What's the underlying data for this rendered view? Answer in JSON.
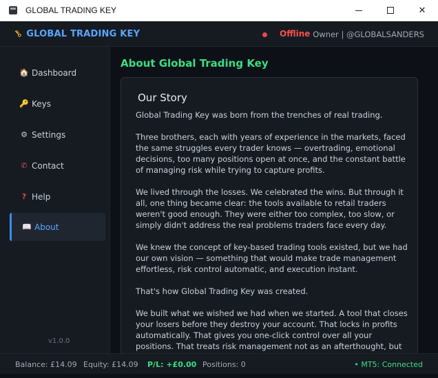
{
  "window": {
    "title": "GLOBAL TRADING KEY",
    "minimize": "",
    "maximize": "",
    "close": "✕"
  },
  "header": {
    "brand": "GLOBAL TRADING KEY",
    "status": "Offline",
    "owner": "Owner | @GLOBALSANDERS",
    "colors": {
      "brand": "#58a6ff",
      "offline": "#f85149"
    }
  },
  "sidebar": {
    "items": [
      {
        "label": "Dashboard",
        "icon": "home-icon"
      },
      {
        "label": "Keys",
        "icon": "key-icon"
      },
      {
        "label": "Settings",
        "icon": "gear-icon"
      },
      {
        "label": "Contact",
        "icon": "phone-icon"
      },
      {
        "label": "Help",
        "icon": "question-icon"
      },
      {
        "label": "About",
        "icon": "book-icon",
        "active": true
      }
    ],
    "version": "v1.0.0"
  },
  "main": {
    "title": "About Global Trading Key",
    "card": {
      "heading": "Our Story",
      "paragraphs": [
        "Global Trading Key was born from the trenches of real trading.",
        "Three brothers, each with years of experience in the markets, faced the same struggles every trader knows — overtrading, emotional decisions, too many positions open at once, and the constant battle of managing risk while trying to capture profits.",
        "We lived through the losses. We celebrated the wins. But through it all, one thing became clear: the tools available to retail traders weren't good enough. They were either too complex, too slow, or simply didn't address the real problems traders face every day.",
        "We knew the concept of key-based trading tools existed, but we had our own vision — something that would make trade management effortless, risk control automatic, and execution instant.",
        "That's how Global Trading Key was created.",
        "We built what we wished we had when we started. A tool that closes your losers before they destroy your account. That locks in profits automatically. That gives you one-click control over all your positions. That treats risk management not as an afterthought, but as the"
      ]
    }
  },
  "statusbar": {
    "balance": "Balance: £14.09",
    "equity": "Equity: £14.09",
    "pl": "P/L: +£0.00",
    "positions": "Positions: 0",
    "connection": "• MT5: Connected"
  }
}
